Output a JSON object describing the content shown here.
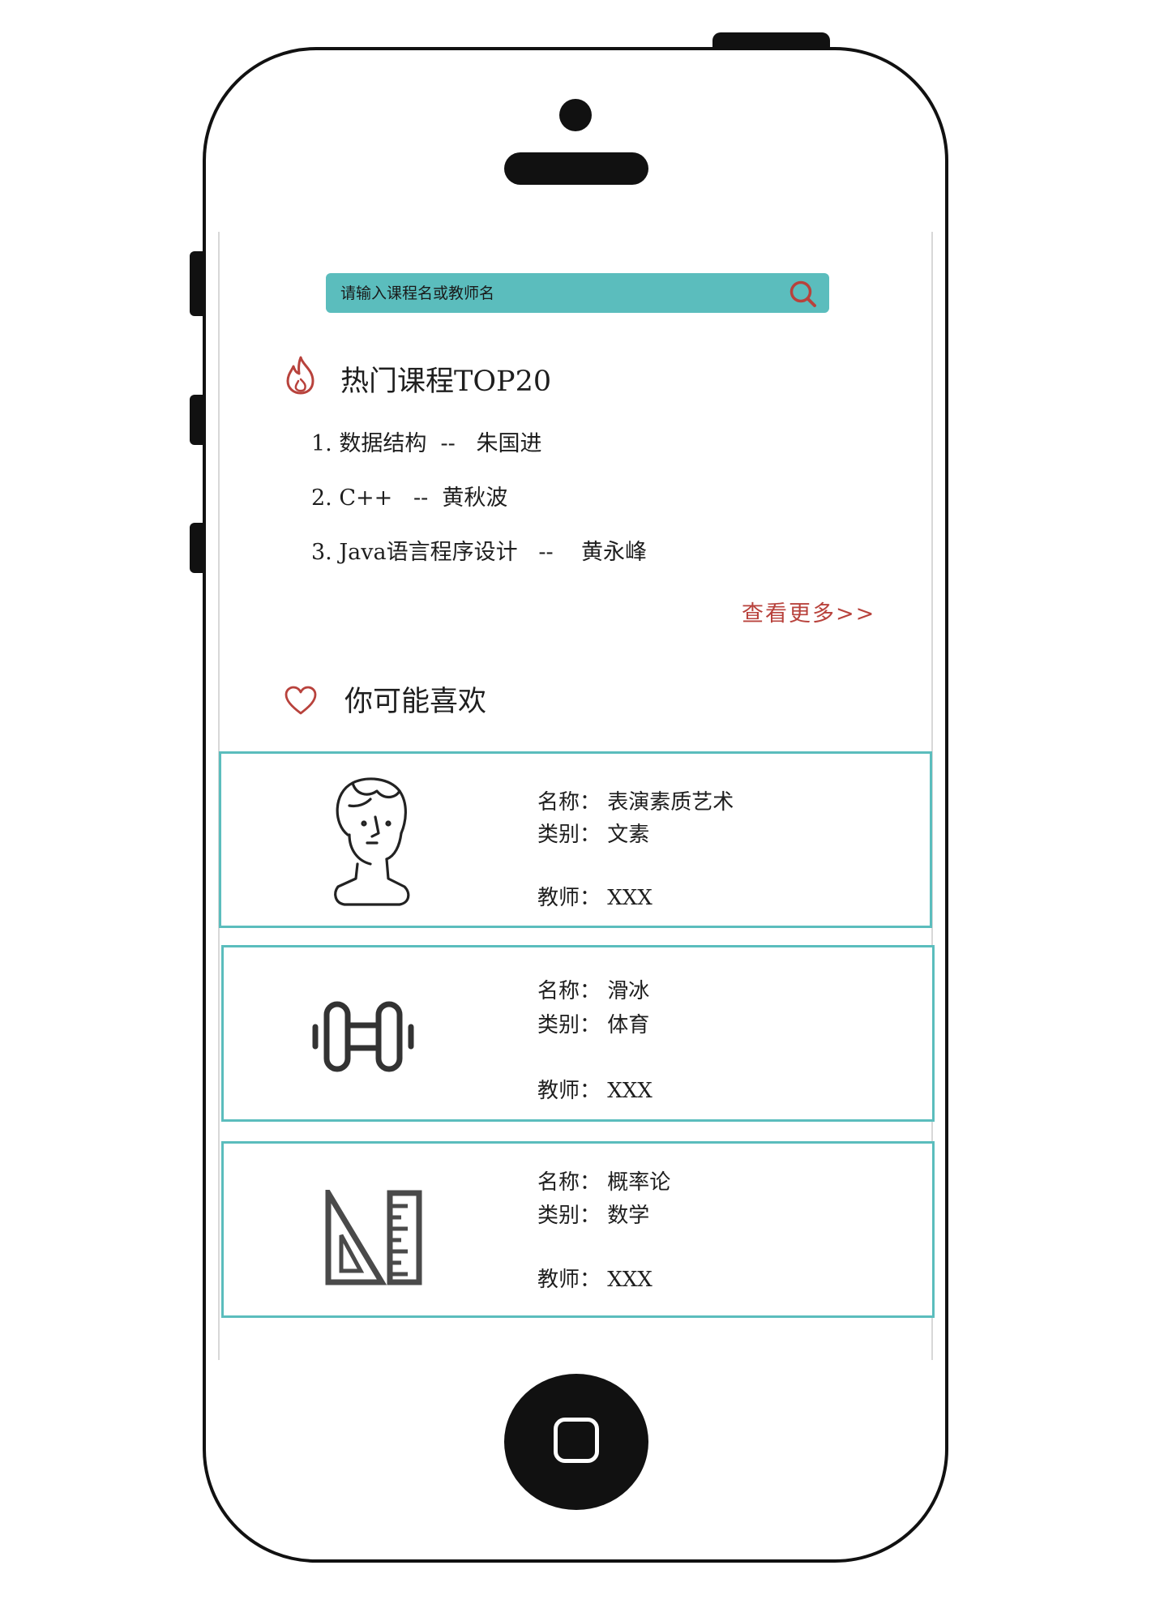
{
  "search": {
    "placeholder": "请输入课程名或教师名",
    "icon": "search-icon"
  },
  "hot": {
    "icon": "flame-icon",
    "title": "热门课程TOP20",
    "items": [
      "1. 数据结构  --   朱国进",
      "2. C++   --  黄秋波",
      "3. Java语言程序设计   --    黄永峰"
    ],
    "more": "查看更多>>"
  },
  "recommend": {
    "icon": "heart-icon",
    "title": "你可能喜欢",
    "cards": [
      {
        "icon": "statue-bust-icon",
        "name_line": "名称： 表演素质艺术",
        "type_line": "类别： 文素",
        "teacher_line": "教师： XXX"
      },
      {
        "icon": "dumbbell-icon",
        "name_line": "名称： 滑冰",
        "type_line": "类别： 体育",
        "teacher_line": "教师： XXX"
      },
      {
        "icon": "ruler-triangle-icon",
        "name_line": "名称： 概率论",
        "type_line": "类别： 数学",
        "teacher_line": "教师： XXX"
      }
    ]
  },
  "colors": {
    "accent_teal": "#5bbdbd",
    "accent_red": "#b8423c",
    "text": "#1e1e1e"
  }
}
